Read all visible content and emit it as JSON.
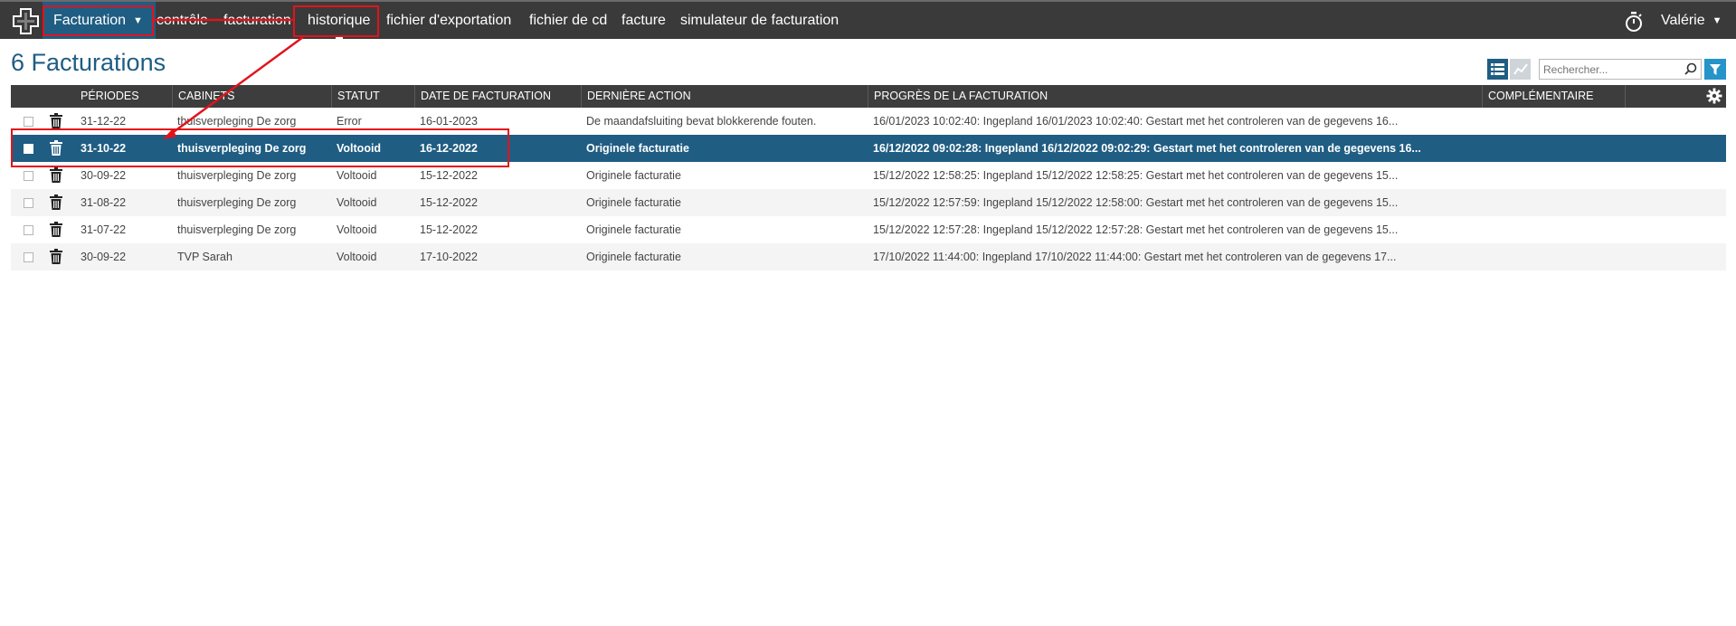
{
  "nav": {
    "dropdown_label": "Facturation",
    "items": [
      "contrôle",
      "facturation",
      "historique",
      "fichier d'exportation",
      "fichier de cd",
      "facture",
      "simulateur de facturation"
    ],
    "user": "Valérie"
  },
  "page_title": "6 Facturations",
  "search": {
    "placeholder": "Rechercher..."
  },
  "table": {
    "columns": [
      "PÉRIODES",
      "CABINETS",
      "STATUT",
      "DATE DE FACTURATION",
      "DERNIÈRE ACTION",
      "PROGRÈS DE LA FACTURATION",
      "COMPLÉMENTAIRE"
    ],
    "rows": [
      {
        "periode": "31-12-22",
        "cabinet": "thuisverpleging De zorg",
        "statut": "Error",
        "date": "16-01-2023",
        "action": "De maandafsluiting bevat blokkerende fouten.",
        "progres": "16/01/2023 10:02:40: Ingepland 16/01/2023 10:02:40: Gestart met het controleren van de gegevens 16...",
        "complementaire": ""
      },
      {
        "periode": "31-10-22",
        "cabinet": "thuisverpleging De zorg",
        "statut": "Voltooid",
        "date": "16-12-2022",
        "action": "Originele facturatie",
        "progres": "16/12/2022 09:02:28: Ingepland 16/12/2022 09:02:29: Gestart met het controleren van de gegevens 16...",
        "complementaire": ""
      },
      {
        "periode": "30-09-22",
        "cabinet": "thuisverpleging De zorg",
        "statut": "Voltooid",
        "date": "15-12-2022",
        "action": "Originele facturatie",
        "progres": "15/12/2022 12:58:25: Ingepland 15/12/2022 12:58:25: Gestart met het controleren van de gegevens 15...",
        "complementaire": ""
      },
      {
        "periode": "31-08-22",
        "cabinet": "thuisverpleging De zorg",
        "statut": "Voltooid",
        "date": "15-12-2022",
        "action": "Originele facturatie",
        "progres": "15/12/2022 12:57:59: Ingepland 15/12/2022 12:58:00: Gestart met het controleren van de gegevens 15...",
        "complementaire": ""
      },
      {
        "periode": "31-07-22",
        "cabinet": "thuisverpleging De zorg",
        "statut": "Voltooid",
        "date": "15-12-2022",
        "action": "Originele facturatie",
        "progres": "15/12/2022 12:57:28: Ingepland 15/12/2022 12:57:28: Gestart met het controleren van de gegevens 15...",
        "complementaire": ""
      },
      {
        "periode": "30-09-22",
        "cabinet": "TVP Sarah",
        "statut": "Voltooid",
        "date": "17-10-2022",
        "action": "Originele facturatie",
        "progres": "17/10/2022 11:44:00: Ingepland 17/10/2022 11:44:00: Gestart met het controleren van de gegevens 17...",
        "complementaire": ""
      }
    ]
  },
  "colors": {
    "nav_bg": "#3a3a3a",
    "accent": "#1f5d83",
    "filter": "#2693c9",
    "annotation": "#e3121b"
  }
}
